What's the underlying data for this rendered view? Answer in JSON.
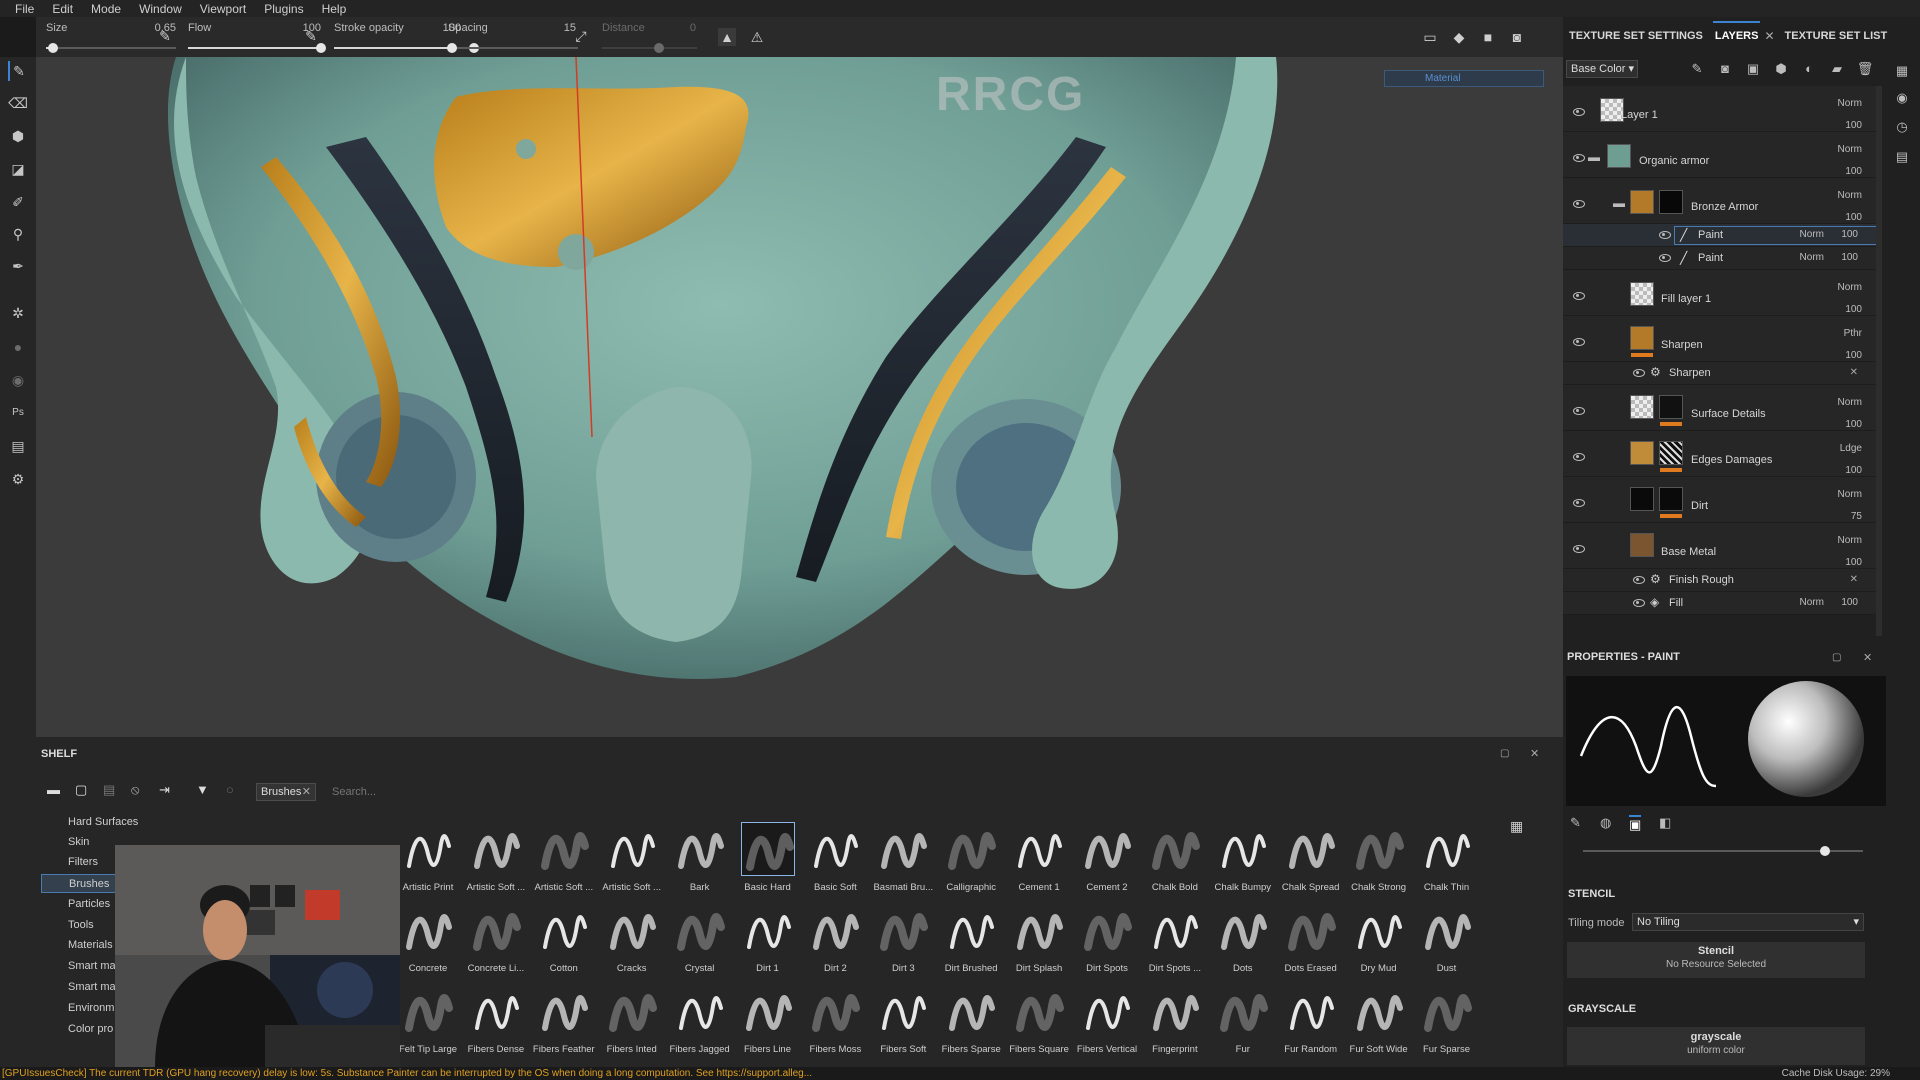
{
  "menu": [
    "File",
    "Edit",
    "Mode",
    "Window",
    "Viewport",
    "Plugins",
    "Help"
  ],
  "toolbar": {
    "size_label": "Size",
    "size_value": "0.65",
    "size_fraction": 0.05,
    "flow_label": "Flow",
    "flow_value": "100",
    "flow_fraction": 1.0,
    "stroke_opacity_label": "Stroke opacity",
    "stroke_opacity_value": "100",
    "stroke_opacity_fraction": 1.0,
    "spacing_label": "Spacing",
    "spacing_value": "15",
    "spacing_fraction": 0.0,
    "distance_label": "Distance",
    "distance_value": "0"
  },
  "watermark": "RRCG",
  "viewport": {
    "material_label": "Material"
  },
  "right_panel": {
    "tabs": [
      "TEXTURE SET SETTINGS",
      "LAYERS",
      "TEXTURE SET LIST"
    ],
    "active_tab": "LAYERS",
    "channel": "Base Color",
    "layers": [
      {
        "name": "Layer 1",
        "blend": "Norm",
        "opacity": "100"
      },
      {
        "name": "Organic armor",
        "blend": "Norm",
        "opacity": "100"
      },
      {
        "name": "Bronze Armor",
        "blend": "Norm",
        "opacity": "100"
      },
      {
        "name": "Paint",
        "blend": "Norm",
        "opacity": "100"
      },
      {
        "name": "Paint",
        "blend": "Norm",
        "opacity": "100"
      },
      {
        "name": "Fill layer 1",
        "blend": "Norm",
        "opacity": "100"
      },
      {
        "name": "Sharpen",
        "blend": "Pthr",
        "opacity": "100"
      },
      {
        "name": "Sharpen",
        "blend": "",
        "opacity": ""
      },
      {
        "name": "Surface Details",
        "blend": "Norm",
        "opacity": "100"
      },
      {
        "name": "Edges Damages",
        "blend": "Ldge",
        "opacity": "100"
      },
      {
        "name": "Dirt",
        "blend": "Norm",
        "opacity": "75"
      },
      {
        "name": "Base Metal",
        "blend": "Norm",
        "opacity": "100"
      },
      {
        "name": "Finish Rough",
        "blend": "",
        "opacity": ""
      },
      {
        "name": "Fill",
        "blend": "Norm",
        "opacity": "100"
      }
    ]
  },
  "properties": {
    "title": "PROPERTIES - PAINT",
    "stencil_header": "STENCIL",
    "tiling_label": "Tiling mode",
    "tiling_value": "No Tiling",
    "stencil_title": "Stencil",
    "stencil_sub": "No Resource Selected",
    "grayscale_header": "GRAYSCALE",
    "grayscale_title": "grayscale",
    "grayscale_sub": "uniform color"
  },
  "shelf": {
    "title": "SHELF",
    "filter_tag": "Brushes",
    "search_placeholder": "Search...",
    "categories": [
      "Hard Surfaces",
      "Skin",
      "Filters",
      "Brushes",
      "Particles",
      "Tools",
      "Materials",
      "Smart ma",
      "Smart ma",
      "Environm",
      "Color pro"
    ],
    "active_category": "Brushes",
    "row1": [
      "Artistic Print",
      "Artistic Soft ...",
      "Artistic Soft ...",
      "Artistic Soft ...",
      "Bark",
      "Basic Hard",
      "Basic Soft",
      "Basmati Bru...",
      "Calligraphic",
      "Cement 1",
      "Cement 2",
      "Chalk Bold",
      "Chalk Bumpy",
      "Chalk Spread",
      "Chalk Strong",
      "Chalk Thin"
    ],
    "row2": [
      "Concrete",
      "Concrete Li...",
      "Cotton",
      "Cracks",
      "Crystal",
      "Dirt 1",
      "Dirt 2",
      "Dirt 3",
      "Dirt Brushed",
      "Dirt Splash",
      "Dirt Spots",
      "Dirt Spots ...",
      "Dots",
      "Dots Erased",
      "Dry Mud",
      "Dust"
    ],
    "row3": [
      "Felt Tip Large",
      "Fibers Dense",
      "Fibers Feather",
      "Fibers Inted",
      "Fibers Jagged",
      "Fibers Line",
      "Fibers Moss",
      "Fibers Soft",
      "Fibers Sparse",
      "Fibers Square",
      "Fibers Vertical",
      "Fingerprint",
      "Fur",
      "Fur Random",
      "Fur Soft Wide",
      "Fur Sparse"
    ],
    "selected_brush": "Basic Hard"
  },
  "status": {
    "message": "[GPUIssuesCheck] The current TDR (GPU hang recovery) delay is low: 5s. Substance Painter can be interrupted by the OS when doing a long computation. See https://support.alleg...",
    "cache_label": "Cache Disk Usage:",
    "cache_value": "29%"
  }
}
